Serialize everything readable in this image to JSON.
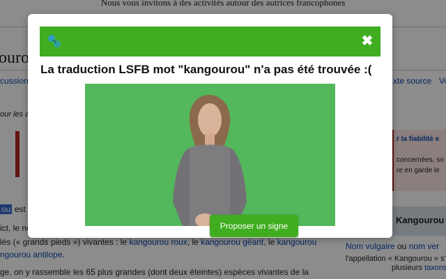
{
  "banner": {
    "text": "Nous vous invitons à des activités autour des autrices francophones"
  },
  "article": {
    "title_fragment": "ourou",
    "tab_left": "cussion",
    "tab_right_1": "xte source",
    "tab_right_2": "Vo",
    "note": "our les a",
    "warning_link": "r la fiabilité e",
    "warning_line_2": "concernées, so",
    "warning_line_3": "re en garde le",
    "line1_hl": "ou",
    "line1_rest": "est",
    "line2": "ict, le no",
    "line3_a": "lés (« grands pieds ») vivantes : le ",
    "line3_link1": "kangourou roux",
    "line3_sep1": ", le ",
    "line3_link2": "kangourou géant",
    "line3_sep2": ", le ",
    "line3_link3": "kangourou",
    "line4_link": "ngourou antilope",
    "line4_rest": ".",
    "line5": "ge, on y rassemble les 65 plus grandes (dont deux éteintes) espèces vivantes de la"
  },
  "infobox": {
    "title": "Kangourou",
    "link1": "Nom vulgaire",
    "or": " ou ",
    "link2": "nom ver",
    "line2": "l'appellation « Kangourou » s'",
    "line3_a": "plusieurs ",
    "line3_link": "taxons"
  },
  "modal": {
    "title": "La traduction LSFB mot \"kangourou\" n'a pas été trouvée :(",
    "close_glyph": "✖",
    "propose_label": "Proposer un signe",
    "header_color": "#3fad1f",
    "video_bg_color": "#53b85b"
  }
}
